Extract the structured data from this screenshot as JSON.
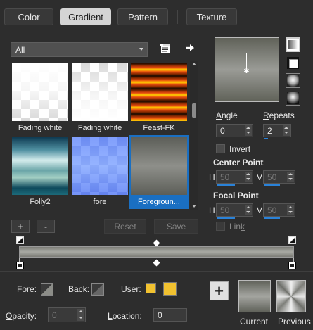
{
  "tabs": [
    {
      "label": "Color"
    },
    {
      "label": "Gradient"
    },
    {
      "label": "Pattern"
    },
    {
      "label": "Texture"
    }
  ],
  "category_dropdown": {
    "value": "All"
  },
  "gradients": [
    {
      "label": "Fading white"
    },
    {
      "label": "Fading white"
    },
    {
      "label": "Feast-FK"
    },
    {
      "label": "Folly2"
    },
    {
      "label": "fore"
    },
    {
      "label": "Foregroun..."
    }
  ],
  "list_buttons": {
    "add": "+",
    "remove": "-",
    "reset": "Reset",
    "save": "Save"
  },
  "settings": {
    "angle_label": "Angle",
    "angle_value": "0",
    "repeats_label": "Repeats",
    "repeats_value": "2",
    "invert_label": "Invert",
    "center_point_label": "Center Point",
    "center_h_label": "H",
    "center_h_value": "50",
    "center_v_label": "V",
    "center_v_value": "50",
    "focal_point_label": "Focal Point",
    "focal_h_label": "H",
    "focal_h_value": "50",
    "focal_v_label": "V",
    "focal_v_value": "50",
    "link_label": "Link"
  },
  "stops": {
    "fore_label": "Fore:",
    "back_label": "Back:",
    "user_label": "User:",
    "opacity_label": "Opacity:",
    "opacity_value": "0",
    "location_label": "Location:",
    "location_value": "0"
  },
  "bottom": {
    "add_button": "+",
    "current_label": "Current",
    "previous_label": "Previous"
  },
  "colors": {
    "accent": "#1a6fc2",
    "user_color": "#f2c230",
    "gradient_gray": "#8c8d88"
  },
  "icons": [
    "manage-icon",
    "arrow-right-icon",
    "linear-style-icon",
    "rectangular-style-icon",
    "sunburst-style-icon",
    "radial-style-icon"
  ]
}
